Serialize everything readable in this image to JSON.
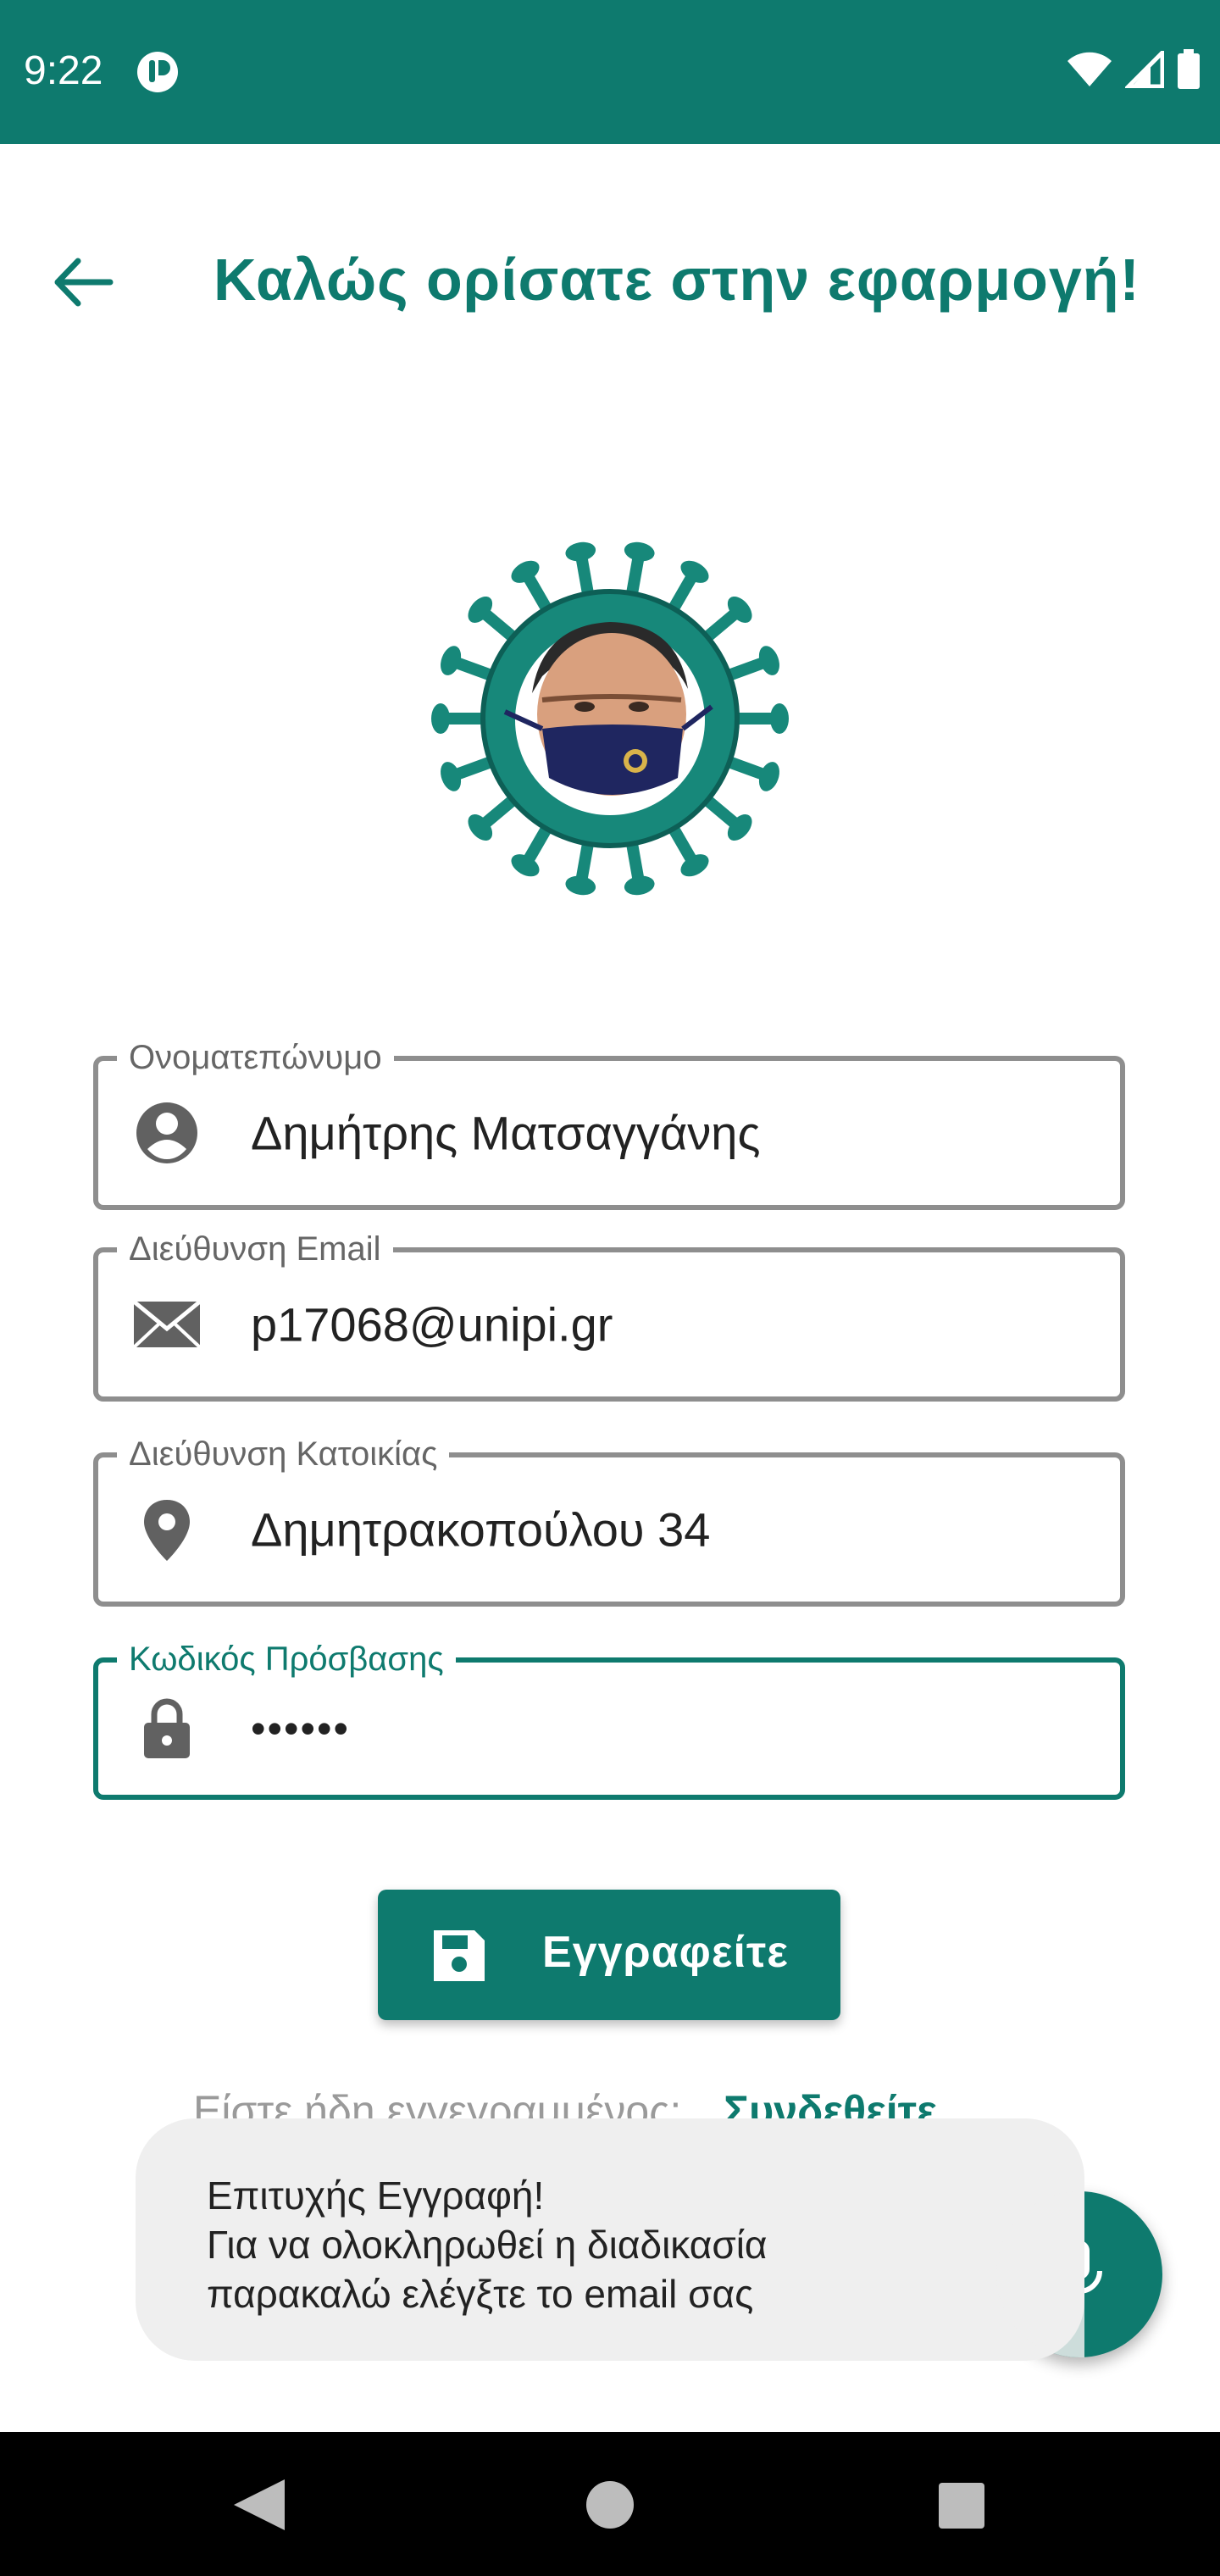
{
  "status_bar": {
    "time": "9:22"
  },
  "header": {
    "title": "Καλώς ορίσατε στην εφαρμογή!"
  },
  "form": {
    "name": {
      "label": "Ονοματεπώνυμο",
      "value": "Δημήτρης Ματσαγγάνης",
      "icon": "account-circle-icon"
    },
    "email": {
      "label": "Διεύθυνση Email",
      "value": "p17068@unipi.gr",
      "icon": "envelope-icon"
    },
    "address": {
      "label": "Διεύθυνση Κατοικίας",
      "value": "Δημητρακοπούλου 34",
      "icon": "location-pin-icon"
    },
    "password": {
      "label": "Κωδικός Πρόσβασης",
      "value": "••••••",
      "icon": "lock-icon"
    }
  },
  "register_button": {
    "label": "Εγγραφείτε",
    "icon": "save-icon"
  },
  "login_prompt": {
    "question": "Είστε ήδη εγγεγραμμένος;",
    "link": "Συνδεθείτε"
  },
  "toast": {
    "line1": "Επιτυχής Εγγραφή!",
    "line2": "Για να ολοκληρωθεί η διαδικασία",
    "line3": "παρακαλώ ελέγξτε το email σας"
  },
  "colors": {
    "primary": "#0e7a6e",
    "toast_bg": "#efefef",
    "border": "#8e8e8e"
  }
}
